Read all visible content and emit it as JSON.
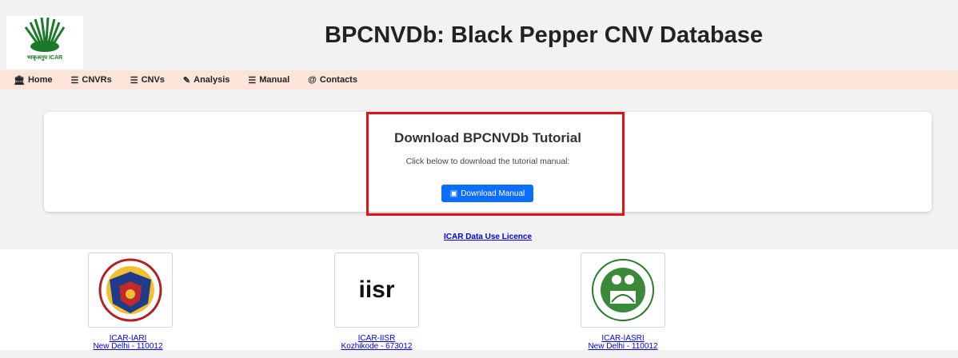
{
  "header": {
    "title": "BPCNVDb: Black Pepper CNV Database",
    "logo_caption": "भाकृअनुप ICAR"
  },
  "nav": {
    "items": [
      {
        "label": "Home",
        "icon": "home-icon"
      },
      {
        "label": "CNVRs",
        "icon": "list-icon"
      },
      {
        "label": "CNVs",
        "icon": "list-icon"
      },
      {
        "label": "Analysis",
        "icon": "edit-icon"
      },
      {
        "label": "Manual",
        "icon": "list-icon"
      },
      {
        "label": "Contacts",
        "icon": "at-icon"
      }
    ]
  },
  "main": {
    "title": "Download BPCNVDb Tutorial",
    "description": "Click below to download the tutorial manual:",
    "button_label": "Download Manual",
    "licence_link": "ICAR Data Use Licence"
  },
  "institutes": [
    {
      "name": "ICAR-IARI",
      "location": "New Delhi - 110012"
    },
    {
      "name": "ICAR-IISR",
      "location": "Kozhikode - 673012",
      "logo_text": "iisr"
    },
    {
      "name": "ICAR-IASRI",
      "location": "New Delhi - 110012"
    }
  ],
  "colors": {
    "nav_bg": "#fde4da",
    "button_bg": "#0d6efd",
    "highlight": "#e01212",
    "link": "#0000ee"
  }
}
